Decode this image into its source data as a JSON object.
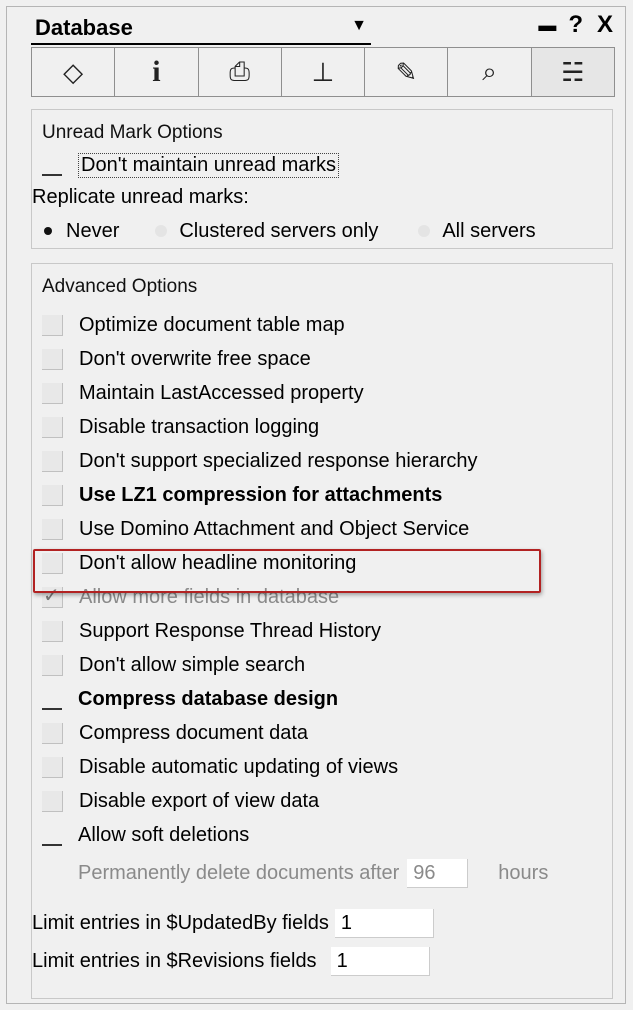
{
  "title_bar": {
    "selector_value": "Database",
    "dropdown_icon": "triangle-down",
    "pin_icon": "minimize-bar",
    "help_label": "?",
    "close_label": "X"
  },
  "tabs": [
    {
      "name": "basics",
      "icon": "basics-icon"
    },
    {
      "name": "info",
      "label": "i"
    },
    {
      "name": "printing",
      "icon": "printer-icon"
    },
    {
      "name": "design",
      "icon": "design-icon"
    },
    {
      "name": "launch",
      "icon": "launch-icon"
    },
    {
      "name": "full-text",
      "icon": "magnifier-icon"
    },
    {
      "name": "advanced",
      "icon": "advanced-icon"
    }
  ],
  "unread": {
    "title": "Unread Mark Options",
    "dont_maintain": "Don't maintain unread marks",
    "replicate_label": "Replicate unread marks:",
    "radio_never": "Never",
    "radio_clustered": "Clustered servers only",
    "radio_all": "All servers",
    "selected": "Never"
  },
  "advanced": {
    "title": "Advanced Options",
    "options": [
      {
        "label": "Optimize document table map",
        "checked": false
      },
      {
        "label": "Don't overwrite free space",
        "checked": false
      },
      {
        "label": "Maintain LastAccessed property",
        "checked": false
      },
      {
        "label": "Disable transaction logging",
        "checked": false
      },
      {
        "label": "Don't support specialized response hierarchy",
        "checked": false
      },
      {
        "label": "Use LZ1 compression for attachments",
        "checked": false
      },
      {
        "label": "Use Domino Attachment and Object Service",
        "checked": false
      },
      {
        "label": "Don't allow headline monitoring",
        "checked": false
      },
      {
        "label": "Allow more fields in database",
        "checked": true
      },
      {
        "label": "Support Response Thread History",
        "checked": false
      },
      {
        "label": "Don't allow simple search",
        "checked": false
      },
      {
        "label": "Compress database design",
        "checked": false
      },
      {
        "label": "Compress document data",
        "checked": false
      },
      {
        "label": "Disable automatic updating of views",
        "checked": false
      },
      {
        "label": "Disable export of view data",
        "checked": false
      },
      {
        "label": "Allow soft deletions",
        "checked": false
      }
    ],
    "perm_delete_label": "Permanently delete documents after",
    "perm_delete_value": "96",
    "perm_delete_unit": "hours",
    "updatedby_label": "Limit entries in $UpdatedBy fields",
    "updatedby_value": "1",
    "revisions_label": "Limit entries in $Revisions fields",
    "revisions_value": "1"
  },
  "colors": {
    "highlight_border": "#b22222",
    "panel_bg": "#f0f0f0"
  }
}
